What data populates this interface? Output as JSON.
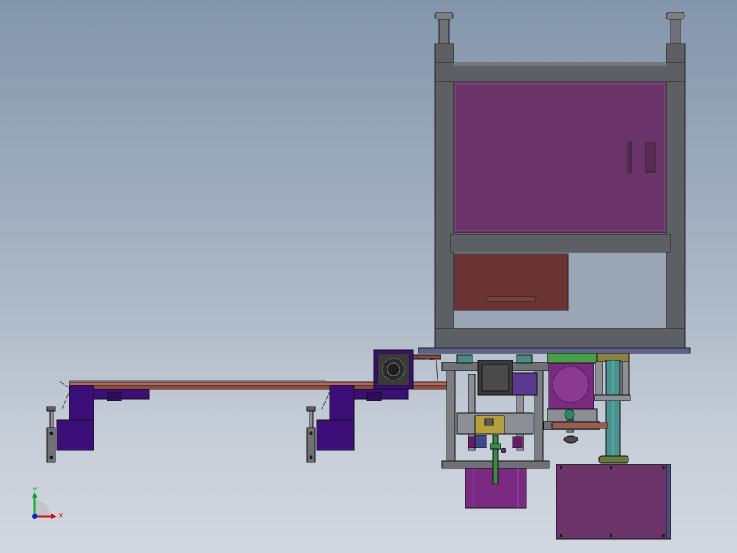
{
  "triad": {
    "x_label": "X",
    "y_label": "Y",
    "x_color": "#cc1111",
    "y_color": "#11aa22",
    "z_color": "#1122cc"
  },
  "palette": {
    "frame": "#5c6064",
    "cabinet_panel": "#6b3468",
    "drawer": "#6a3434",
    "rail": "#9c5c48",
    "bracket": "#3c0f78",
    "column": "#4a9490",
    "block": "#7a2a80",
    "motor": "#3a3a3a"
  }
}
